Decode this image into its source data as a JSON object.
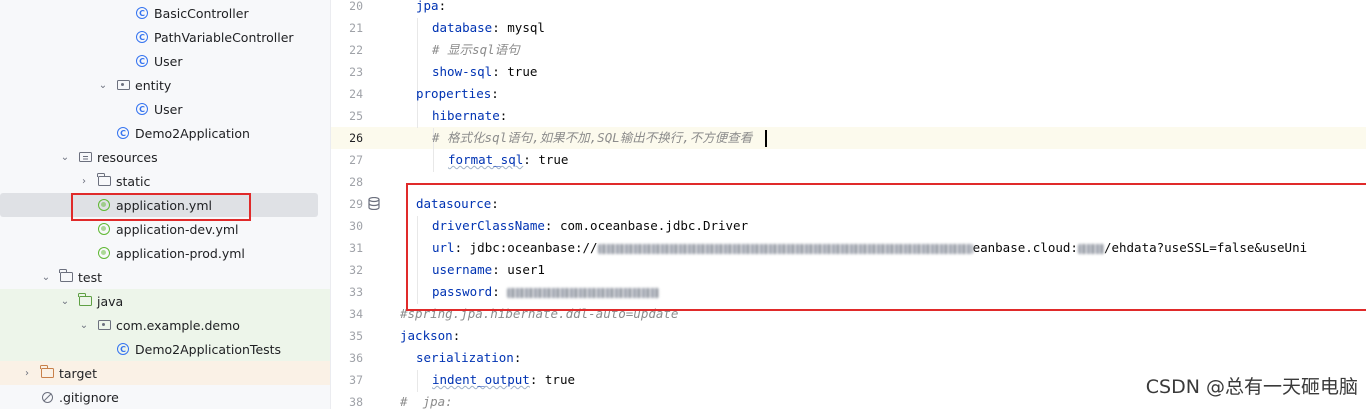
{
  "tree": {
    "items": [
      {
        "label": "BasicController",
        "icon": "class-icon"
      },
      {
        "label": "PathVariableController",
        "icon": "class-icon"
      },
      {
        "label": "User",
        "icon": "class-icon"
      },
      {
        "label": "entity",
        "icon": "package-icon"
      },
      {
        "label": "User",
        "icon": "class-icon"
      },
      {
        "label": "Demo2Application",
        "icon": "spring-app-icon"
      },
      {
        "label": "resources",
        "icon": "resources-folder-icon"
      },
      {
        "label": "static",
        "icon": "folder-icon"
      },
      {
        "label": "application.yml",
        "icon": "yaml-icon"
      },
      {
        "label": "application-dev.yml",
        "icon": "yaml-icon"
      },
      {
        "label": "application-prod.yml",
        "icon": "yaml-icon"
      },
      {
        "label": "test",
        "icon": "folder-icon"
      },
      {
        "label": "java",
        "icon": "test-folder-icon"
      },
      {
        "label": "com.example.demo",
        "icon": "package-icon"
      },
      {
        "label": "Demo2ApplicationTests",
        "icon": "spring-test-icon"
      },
      {
        "label": "target",
        "icon": "excluded-folder-icon"
      },
      {
        "label": ".gitignore",
        "icon": "gitignore-icon"
      }
    ]
  },
  "editor": {
    "line_numbers": [
      "20",
      "21",
      "22",
      "23",
      "24",
      "25",
      "26",
      "27",
      "28",
      "29",
      "30",
      "31",
      "32",
      "33",
      "34",
      "35",
      "36",
      "37",
      "38"
    ],
    "current_line": "26",
    "lines": {
      "l20": {
        "key": "jpa"
      },
      "l21": {
        "key": "database",
        "value": "mysql"
      },
      "l22": {
        "comment": "# 显示sql语句"
      },
      "l23": {
        "key": "show-sql",
        "value": "true"
      },
      "l24": {
        "key": "properties"
      },
      "l25": {
        "key": "hibernate"
      },
      "l26": {
        "comment": "# 格式化sql语句,如果不加,SQL输出不换行,不方便查看"
      },
      "l27": {
        "key": "format_sql",
        "value": "true"
      },
      "l29": {
        "key": "datasource"
      },
      "l30": {
        "key": "driverClassName",
        "value": "com.oceanbase.jdbc.Driver"
      },
      "l31": {
        "key": "url",
        "value_start": "jdbc:oceanbase://",
        "value_mid": "eanbase.cloud:",
        "value_end": "/ehdata?useSSL=false&useUni"
      },
      "l32": {
        "key": "username",
        "value": "user1"
      },
      "l33": {
        "key": "password"
      },
      "l34": {
        "comment": "#spring.jpa.hibernate.ddl-auto=update"
      },
      "l35": {
        "key": "jackson"
      },
      "l36": {
        "key": "serialization"
      },
      "l37": {
        "key": "indent_output",
        "value": "true"
      },
      "l38": {
        "comment": "#  jpa:"
      }
    }
  },
  "watermark": "CSDN @总有一天砸电脑",
  "colors": {
    "highlight_red": "#e02a2a",
    "keyword": "#0033b3",
    "comment": "#8c8c8c"
  }
}
